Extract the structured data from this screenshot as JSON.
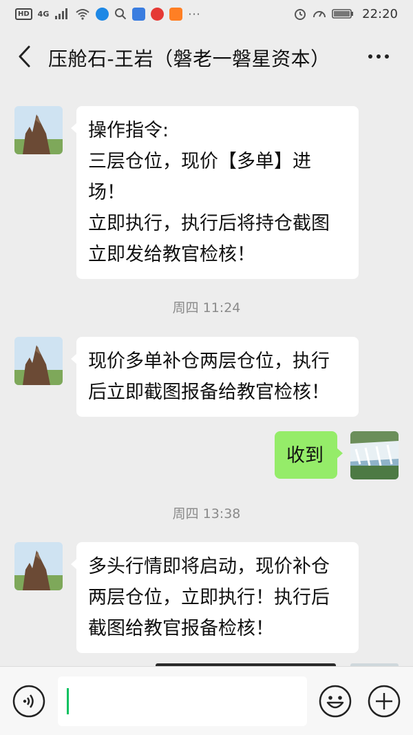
{
  "status_bar": {
    "hd": "HD",
    "network": "4G",
    "time": "22:20"
  },
  "header": {
    "title": "压舱石-王岩（磐老一磐星资本）"
  },
  "messages": [
    {
      "type": "incoming",
      "lines": [
        "操作指令:",
        "三层仓位，现价【多单】进",
        "场！",
        "立即执行，执行后将持仓截图",
        "立即发给教官检核！"
      ]
    },
    {
      "type": "time",
      "text": "周四 11:24"
    },
    {
      "type": "incoming",
      "lines": [
        "现价多单补仓两层仓位，执行",
        "后立即截图报备给教官检核！"
      ]
    },
    {
      "type": "outgoing",
      "text": "收到"
    },
    {
      "type": "time",
      "text": "周四 13:38"
    },
    {
      "type": "incoming",
      "lines": [
        "多头行情即将启动，现价补仓",
        "两层仓位，立即执行！执行后",
        "截图给教官报备检核！"
      ]
    }
  ],
  "input_bar": {
    "text": ""
  },
  "colors": {
    "background": "#ededed",
    "incoming_bubble": "#ffffff",
    "outgoing_bubble": "#95ec69",
    "caret": "#07c160"
  },
  "icons": {
    "back": "chevron-left-icon",
    "more": "more-dots-icon",
    "voice": "voice-icon",
    "emoji": "emoji-icon",
    "plus": "plus-icon"
  }
}
